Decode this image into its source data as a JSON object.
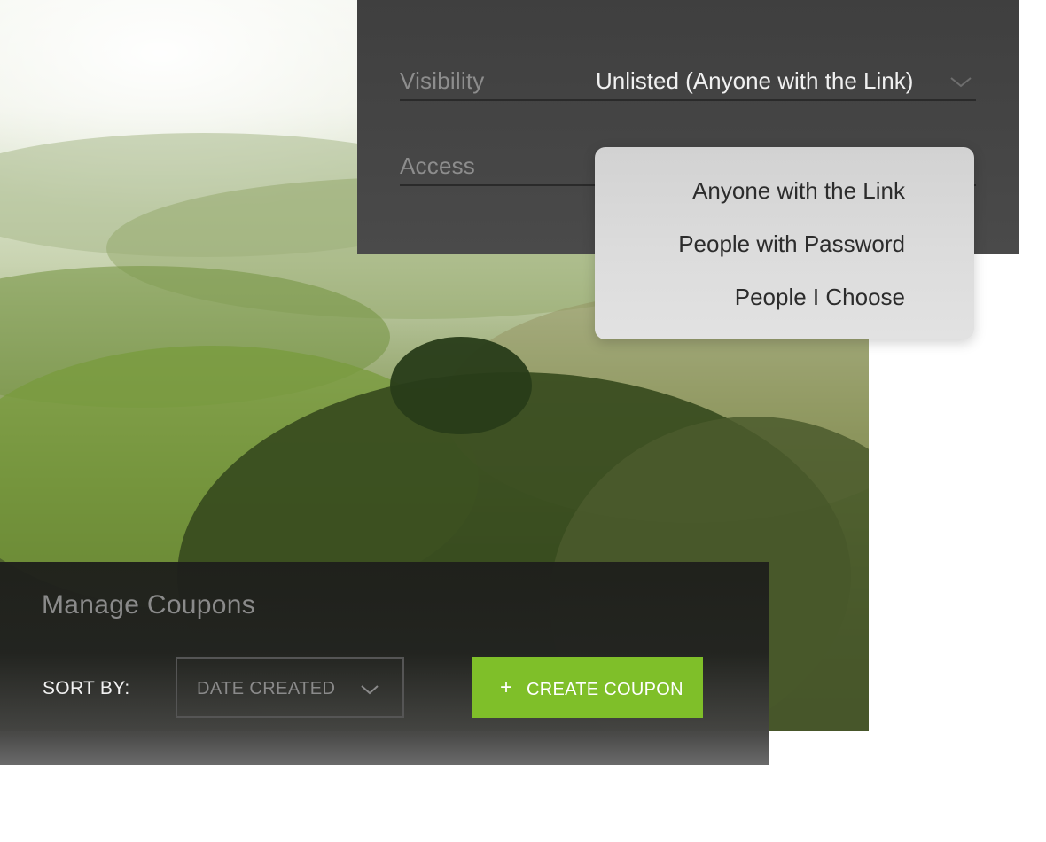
{
  "settings": {
    "visibility_label": "Visibility",
    "visibility_value": "Unlisted (Anyone with the Link)",
    "access_label": "Access"
  },
  "access_menu": {
    "items": [
      {
        "label": "Anyone with the Link"
      },
      {
        "label": "People with Password"
      },
      {
        "label": "People I Choose"
      }
    ]
  },
  "coupons": {
    "title": "Manage Coupons",
    "sort_label": "SORT BY:",
    "sort_value": "DATE CREATED",
    "create_plus": "+",
    "create_label": "CREATE COUPON"
  },
  "colors": {
    "accent": "#7fbf29",
    "panel_dark": "#4a4a4a",
    "menu_bg": "#dcdcdc"
  },
  "icons": {
    "visibility_chevron": "chevron-down-icon",
    "sort_chevron": "chevron-down-icon",
    "create_plus": "plus-icon"
  }
}
